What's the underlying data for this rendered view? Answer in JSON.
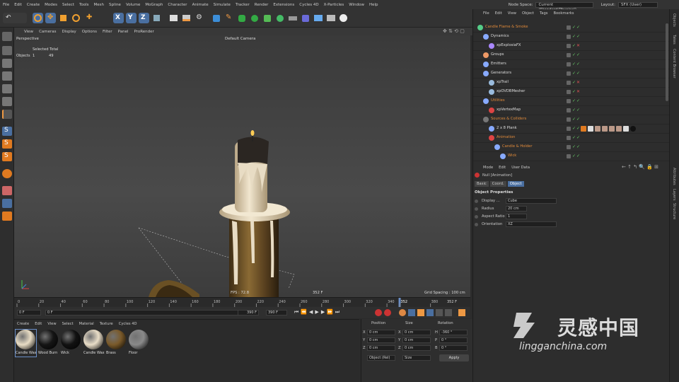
{
  "menu": [
    "File",
    "Edit",
    "Create",
    "Modes",
    "Select",
    "Tools",
    "Mesh",
    "Spline",
    "Volume",
    "MoGraph",
    "Character",
    "Animate",
    "Simulate",
    "Tracker",
    "Render",
    "Extensions",
    "Cycles 4D",
    "X-Particles",
    "Window",
    "Help"
  ],
  "top_right": {
    "node_space_label": "Node Space:",
    "node_space_value": "Current (Standard/Physical)",
    "layout_label": "Layout:",
    "layout_value": "SFX (User)"
  },
  "viewport_menu": [
    "View",
    "Cameras",
    "Display",
    "Options",
    "Filter",
    "Panel",
    "ProRender"
  ],
  "viewport": {
    "mode": "Perspective",
    "camera": "Default Camera",
    "selected_total": "Selected Total",
    "objects_label": "Objects",
    "objects_count": "1",
    "objects_total": "49",
    "fps": "FPS : 72.8",
    "frame": "352 F",
    "grid_spacing": "Grid Spacing : 100 cm"
  },
  "timeline": {
    "ticks": [
      "0",
      "20",
      "40",
      "60",
      "80",
      "100",
      "120",
      "140",
      "160",
      "180",
      "200",
      "220",
      "240",
      "260",
      "280",
      "300",
      "320",
      "340",
      "352",
      "380"
    ],
    "current_display": "352 F"
  },
  "transport": {
    "start": "0 F",
    "start2": "0 F",
    "end": "390 F",
    "end2": "390 F"
  },
  "material_menu": [
    "Create",
    "Edit",
    "View",
    "Select",
    "Material",
    "Texture",
    "Cycles 4D"
  ],
  "materials": [
    {
      "name": "Candle Wax",
      "color": "#e8dcc4"
    },
    {
      "name": "Wood Burn",
      "color": "#151515"
    },
    {
      "name": "Wick",
      "color": "#121212"
    },
    {
      "name": "Candle Wax",
      "color": "#e9ddc7"
    },
    {
      "name": "Brass",
      "color": "#7a5a2a"
    },
    {
      "name": "Floor",
      "color": "#8a8a8a"
    }
  ],
  "coords": {
    "headers": [
      "Position",
      "Size",
      "Rotation"
    ],
    "rows": [
      {
        "axis": "X",
        "pos": "0 cm",
        "saxis": "X",
        "size": "0 cm",
        "raxis": "H",
        "rot": "-360 °"
      },
      {
        "axis": "Y",
        "pos": "0 cm",
        "saxis": "Y",
        "size": "0 cm",
        "raxis": "P",
        "rot": "0 °"
      },
      {
        "axis": "Z",
        "pos": "0 cm",
        "saxis": "Z",
        "size": "0 cm",
        "raxis": "B",
        "rot": "0 °"
      }
    ],
    "mode": "Object (Rel)",
    "size_mode": "Size",
    "apply": "Apply"
  },
  "objects_menu": [
    "File",
    "Edit",
    "View",
    "Object",
    "Tags",
    "Bookmarks"
  ],
  "objects": [
    {
      "name": "Candle Flame & Smoke",
      "indent": 0,
      "color": "#e08a3a",
      "icon": "#5c8",
      "state": "ok"
    },
    {
      "name": "Dynamics",
      "indent": 1,
      "color": "#ddd",
      "icon": "#8af",
      "state": "ok"
    },
    {
      "name": "xpExplosiaFX",
      "indent": 2,
      "color": "#ddd",
      "icon": "#a8f",
      "state": "x"
    },
    {
      "name": "Groups",
      "indent": 1,
      "color": "#ddd",
      "icon": "#e96",
      "state": "ok"
    },
    {
      "name": "Emitters",
      "indent": 1,
      "color": "#ddd",
      "icon": "#8af",
      "state": "ok"
    },
    {
      "name": "Generators",
      "indent": 1,
      "color": "#ddd",
      "icon": "#8af",
      "state": "ok"
    },
    {
      "name": "xpTrail",
      "indent": 2,
      "color": "#ddd",
      "icon": "#9bd",
      "state": "x"
    },
    {
      "name": "xpOVDBMesher",
      "indent": 2,
      "color": "#ddd",
      "icon": "#9bd",
      "state": "x"
    },
    {
      "name": "Utilities",
      "indent": 1,
      "color": "#e08a3a",
      "icon": "#8af",
      "state": "ok"
    },
    {
      "name": "xpVertexMap",
      "indent": 2,
      "color": "#ddd",
      "icon": "#d44",
      "state": "ok"
    },
    {
      "name": "Sources & Colliders",
      "indent": 1,
      "color": "#e08a3a",
      "icon": "#777",
      "state": "ok"
    },
    {
      "name": "2 x 8 Plank",
      "indent": 2,
      "color": "#ddd",
      "icon": "#8af",
      "state": "ok"
    },
    {
      "name": "Animation",
      "indent": 2,
      "color": "#e08a3a",
      "icon": "#d44",
      "state": "ok"
    },
    {
      "name": "Candle & Holder",
      "indent": 3,
      "color": "#e08a3a",
      "icon": "#8af",
      "state": "ok"
    },
    {
      "name": "Wick",
      "indent": 4,
      "color": "#e08a3a",
      "icon": "#8af",
      "state": "ok"
    }
  ],
  "attr_menu": [
    "Mode",
    "Edit",
    "User Data"
  ],
  "attributes": {
    "title": "Null [Animation]",
    "tabs": [
      "Basic",
      "Coord.",
      "Object"
    ],
    "section": "Object Properties",
    "rows": [
      {
        "label": "Display ...",
        "value": "Cube"
      },
      {
        "label": "Radius",
        "value": "20 cm"
      },
      {
        "label": "Aspect Ratio",
        "value": "1"
      },
      {
        "label": "Orientation",
        "value": "XZ"
      }
    ]
  },
  "side_tabs_top": [
    "Objects",
    "Takes",
    "Content Browser"
  ],
  "side_tabs_bottom": [
    "Attributes",
    "Layers",
    "Structure"
  ],
  "watermark": {
    "brand": "灵感中国",
    "url": "lingganchina.com"
  }
}
